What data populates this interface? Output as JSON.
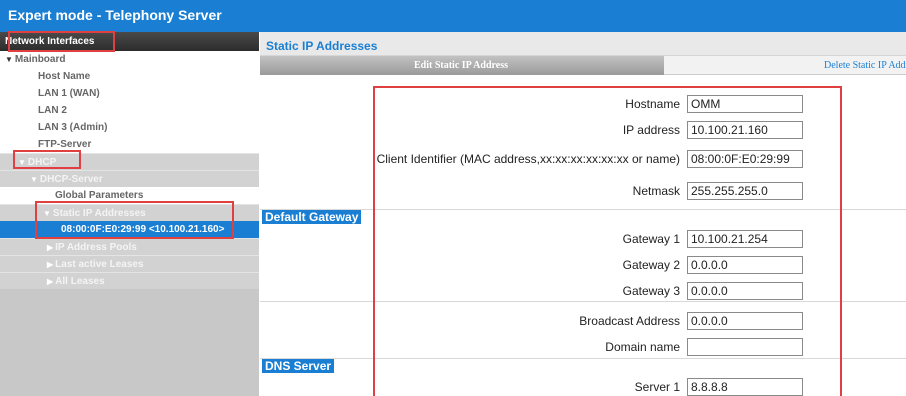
{
  "window": {
    "title": "Expert mode - Telephony Server"
  },
  "sidebar": {
    "header": "Network Interfaces",
    "items": [
      {
        "label": "Mainboard"
      },
      {
        "label": "Host Name"
      },
      {
        "label": "LAN 1 (WAN)"
      },
      {
        "label": "LAN 2"
      },
      {
        "label": "LAN 3 (Admin)"
      },
      {
        "label": "FTP-Server"
      },
      {
        "label": "DHCP"
      },
      {
        "label": "DHCP-Server"
      },
      {
        "label": "Global Parameters"
      },
      {
        "label": "Static IP Addresses"
      },
      {
        "label": "08:00:0F:E0:29:99 <10.100.21.160>"
      },
      {
        "label": "IP Address Pools"
      },
      {
        "label": "Last active Leases"
      },
      {
        "label": "All Leases"
      }
    ]
  },
  "main": {
    "title": "Static IP Addresses",
    "tabs": [
      {
        "label": "Edit Static IP Address"
      },
      {
        "label": "Delete Static IP Address"
      }
    ],
    "fields": {
      "hostname": {
        "label": "Hostname",
        "value": "OMM"
      },
      "ip_address": {
        "label": "IP address",
        "value": "10.100.21.160"
      },
      "client_identifier": {
        "label": "Client Identifier (MAC address,xx:xx:xx:xx:xx:xx or name)",
        "value": "08:00:0F:E0:29:99"
      },
      "netmask": {
        "label": "Netmask",
        "value": "255.255.255.0"
      },
      "gateway1": {
        "label": "Gateway 1",
        "value": "10.100.21.254"
      },
      "gateway2": {
        "label": "Gateway 2",
        "value": "0.0.0.0"
      },
      "gateway3": {
        "label": "Gateway 3",
        "value": "0.0.0.0"
      },
      "broadcast": {
        "label": "Broadcast Address",
        "value": "0.0.0.0"
      },
      "domain": {
        "label": "Domain name",
        "value": ""
      },
      "dns1": {
        "label": "Server 1",
        "value": "8.8.8.8"
      }
    },
    "sections": {
      "default_gateway": "Default Gateway",
      "dns_server": "DNS Server"
    }
  },
  "colors": {
    "accent": "#1a7fd3",
    "highlight": "#e04040",
    "sidebar_bg": "#c8c8c8"
  }
}
